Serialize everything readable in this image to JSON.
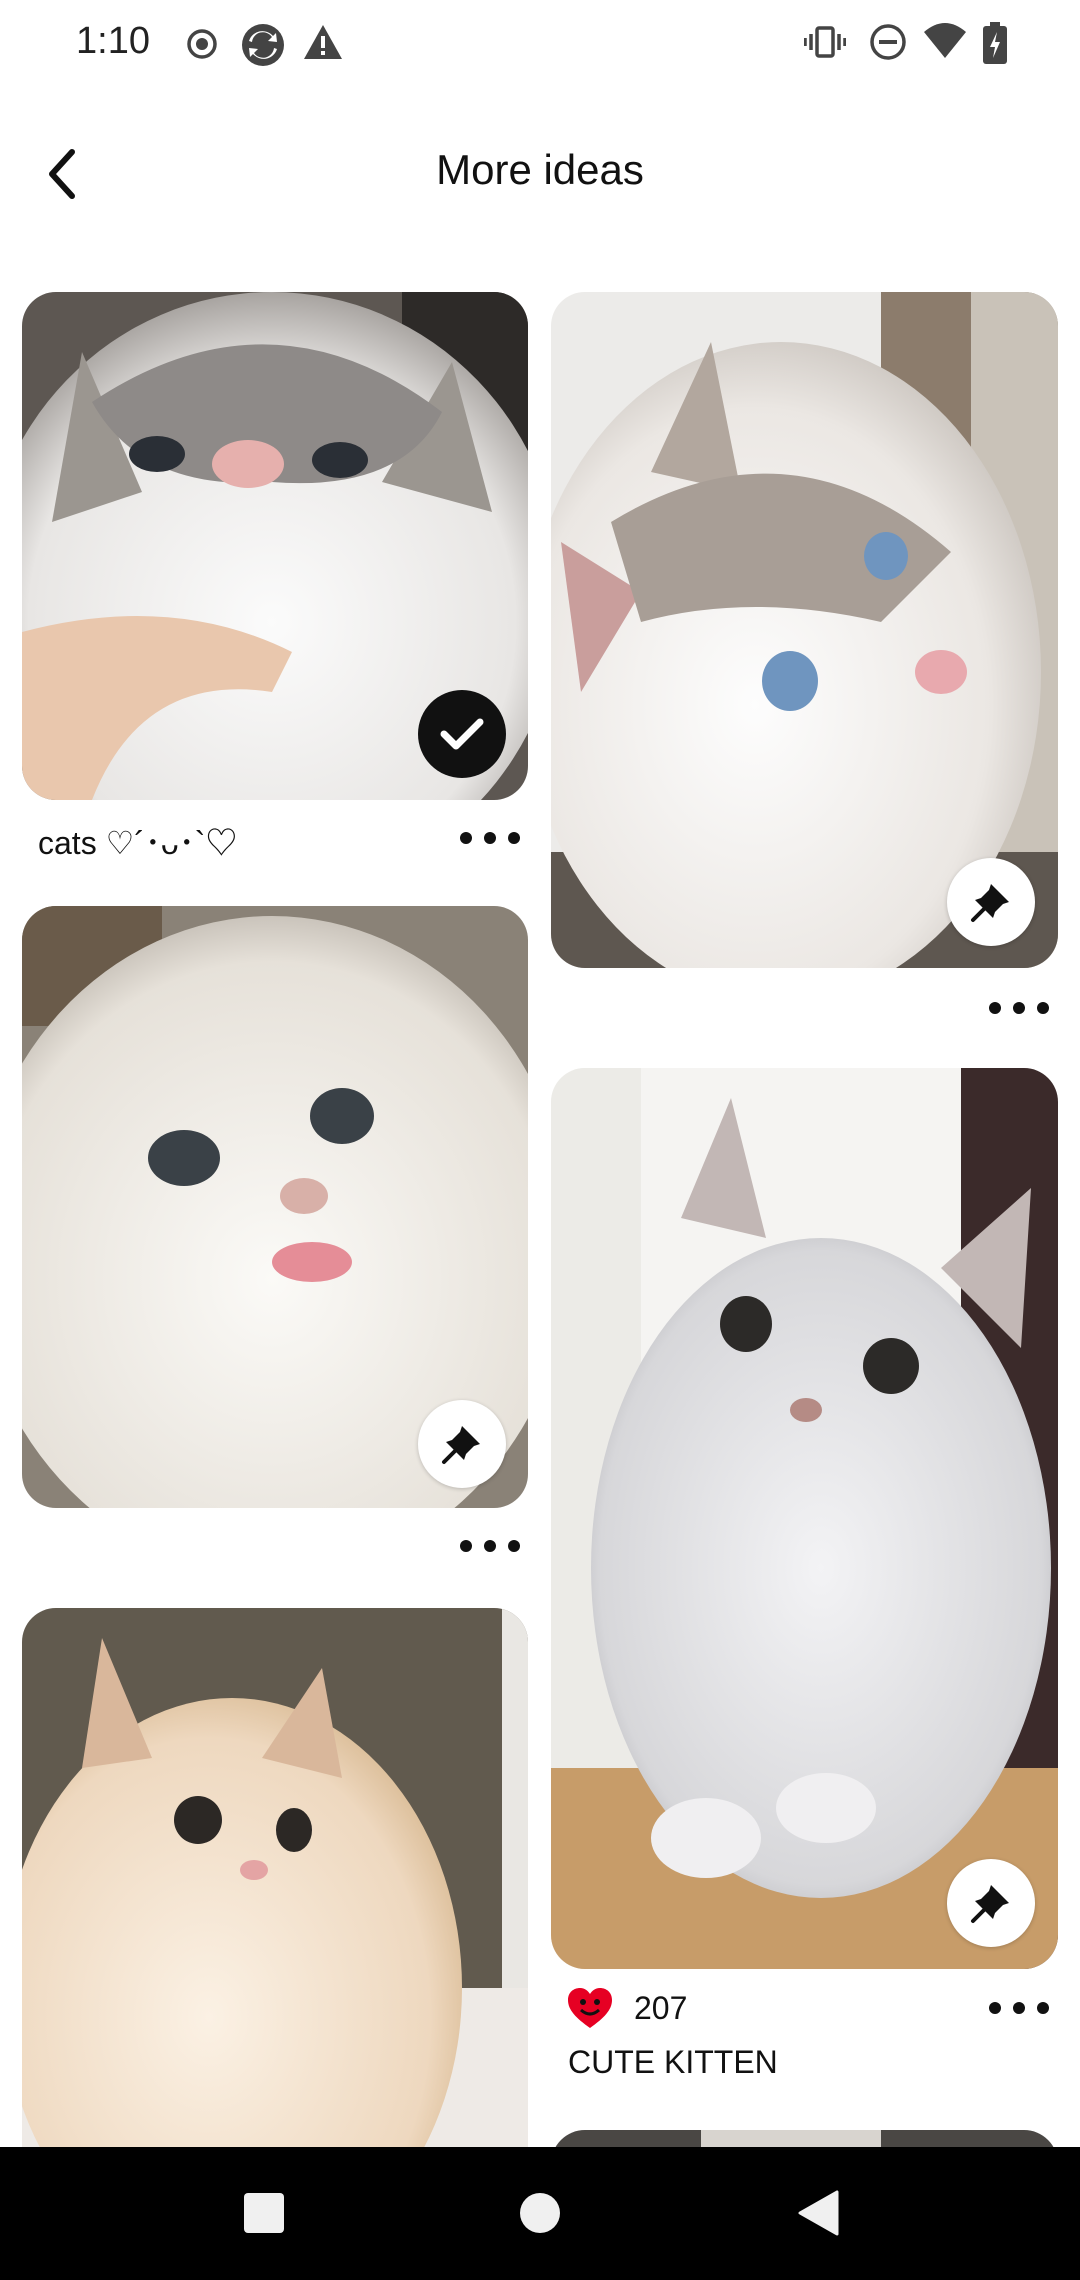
{
  "status_bar": {
    "time": "1:10",
    "left_icons": [
      "record-icon",
      "sync-icon",
      "warning-icon"
    ],
    "right_icons": [
      "vibrate-icon",
      "do-not-disturb-icon",
      "wifi-icon",
      "battery-icon"
    ]
  },
  "header": {
    "title": "More ideas",
    "back_icon": "back-arrow-icon"
  },
  "pins": [
    {
      "title": "cats ♡´･ᴗ･`♡",
      "state": "saved",
      "icon": "checkmark-icon"
    },
    {
      "title": "",
      "state": "not-saved",
      "icon": "pin-icon"
    },
    {
      "title": "",
      "state": "not-saved",
      "icon": "pin-icon"
    },
    {
      "title": "CUTE KITTEN",
      "state": "not-saved",
      "icon": "pin-icon",
      "likes": "207",
      "reaction_icon": "heart-face-icon"
    },
    {
      "title": "",
      "state": "partial"
    }
  ],
  "nav_bar": [
    "recents-square-icon",
    "home-circle-icon",
    "back-triangle-icon"
  ],
  "colors": {
    "background": "#ffffff",
    "saved_badge": "#111111",
    "reaction": "#e60023",
    "nav_bar": "#000000"
  }
}
